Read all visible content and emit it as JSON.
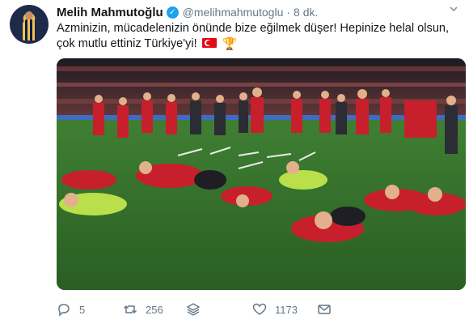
{
  "author": {
    "display_name": "Melih Mahmutoğlu",
    "handle": "@melihmahmutoglu",
    "separator": "·",
    "time": "8 dk."
  },
  "tweet": {
    "text": "Azminizin, mücadelenizin önünde bize eğilmek düşer! Hepinize helal olsun, çok mutlu ettiniz Türkiye'yi!",
    "emojis": [
      "turkey-flag",
      "trophy"
    ]
  },
  "actions": {
    "reply_count": "5",
    "retweet_count": "256",
    "like_count": "1173"
  },
  "colors": {
    "accent": "#1da1f2",
    "muted": "#657786",
    "text": "#14171a"
  },
  "icons": [
    "verified-icon",
    "chevron-down-icon",
    "reply-icon",
    "retweet-icon",
    "stack-icon",
    "like-icon",
    "message-icon"
  ]
}
